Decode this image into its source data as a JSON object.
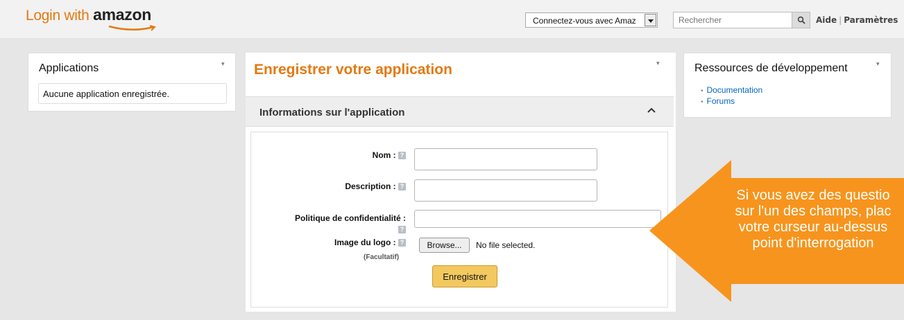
{
  "header": {
    "logo_prefix": "Login with ",
    "logo_brand": "amazon",
    "language_select": "Connectez-vous avec Amaz",
    "search_placeholder": "Rechercher",
    "help_link": "Aide",
    "settings_link": "Paramètres"
  },
  "applications": {
    "title": "Applications",
    "empty_text": "Aucune application enregistrée."
  },
  "main": {
    "title": "Enregistrer votre application",
    "section_title": "Informations sur l'application",
    "form": {
      "name_label": "Nom :",
      "description_label": "Description :",
      "privacy_label": "Politique de confidentialité :",
      "logo_label": "Image du logo :",
      "optional_label": "(Facultatif)",
      "browse_button": "Browse...",
      "no_file": "No file selected.",
      "submit_button": "Enregistrer",
      "help_glyph": "?"
    }
  },
  "resources": {
    "title": "Ressources de développement",
    "links": [
      "Documentation",
      "Forums"
    ]
  },
  "callout": {
    "lines": [
      "Si vous avez des questio",
      "sur l'un des champs, plac",
      "votre curseur au-dessus",
      "point d'interrogation"
    ],
    "color": "#f7941d"
  },
  "colors": {
    "accent": "#e47911",
    "link": "#0066c0",
    "button": "#f3c85f"
  }
}
